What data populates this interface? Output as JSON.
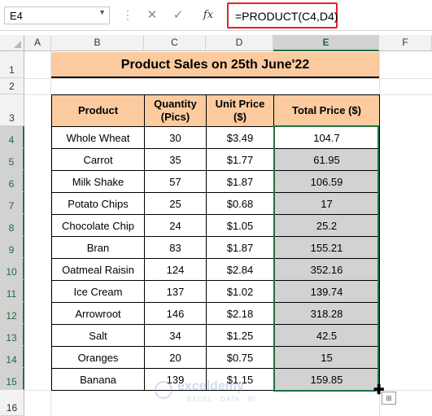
{
  "formula_bar": {
    "name_box": "E4",
    "cancel_icon": "✕",
    "enter_icon": "✓",
    "fx_label": "fx",
    "formula": "=PRODUCT(C4,D4)"
  },
  "columns": [
    "A",
    "B",
    "C",
    "D",
    "E",
    "F"
  ],
  "rows": [
    "1",
    "2",
    "3",
    "4",
    "5",
    "6",
    "7",
    "8",
    "9",
    "10",
    "11",
    "12",
    "13",
    "14",
    "15",
    "16"
  ],
  "selected_column": "E",
  "selected_rows": [
    "4",
    "5",
    "6",
    "7",
    "8",
    "9",
    "10",
    "11",
    "12",
    "13",
    "14",
    "15"
  ],
  "sheet": {
    "title": "Product Sales on 25th June'22",
    "headers": {
      "product": "Product",
      "quantity_line1": "Quantity",
      "quantity_line2": "(Pics)",
      "unit_price_line1": "Unit Price",
      "unit_price_line2": "($)",
      "total": "Total Price ($)"
    },
    "items": [
      {
        "product": "Whole Wheat",
        "qty": "30",
        "price": "$3.49",
        "total": "104.7"
      },
      {
        "product": "Carrot",
        "qty": "35",
        "price": "$1.77",
        "total": "61.95"
      },
      {
        "product": "Milk Shake",
        "qty": "57",
        "price": "$1.87",
        "total": "106.59"
      },
      {
        "product": "Potato Chips",
        "qty": "25",
        "price": "$0.68",
        "total": "17"
      },
      {
        "product": "Chocolate Chip",
        "qty": "24",
        "price": "$1.05",
        "total": "25.2"
      },
      {
        "product": "Bran",
        "qty": "83",
        "price": "$1.87",
        "total": "155.21"
      },
      {
        "product": "Oatmeal Raisin",
        "qty": "124",
        "price": "$2.84",
        "total": "352.16"
      },
      {
        "product": "Ice Cream",
        "qty": "137",
        "price": "$1.02",
        "total": "139.74"
      },
      {
        "product": "Arrowroot",
        "qty": "146",
        "price": "$2.18",
        "total": "318.28"
      },
      {
        "product": "Salt",
        "qty": "34",
        "price": "$1.25",
        "total": "42.5"
      },
      {
        "product": "Oranges",
        "qty": "20",
        "price": "$0.75",
        "total": "15"
      },
      {
        "product": "Banana",
        "qty": "139",
        "price": "$1.15",
        "total": "159.85"
      }
    ]
  },
  "watermark": {
    "name": "exceldemy",
    "tagline": "EXCEL · DATA · BI"
  },
  "colors": {
    "header_fill": "#fbcb9f",
    "selection_border": "#1f7244",
    "selection_fill": "#d2d2d2",
    "formula_highlight": "#e8202a"
  }
}
